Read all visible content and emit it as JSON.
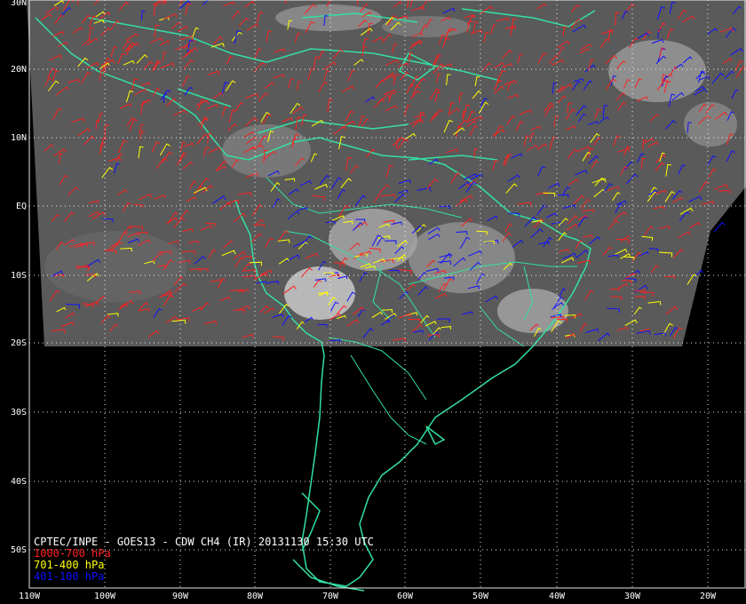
{
  "title": "CPTEC/INPE - GOES13 - CDW CH4 (IR) 20131130 15:30 UTC",
  "legend": [
    {
      "label": "1000-700 hPa",
      "color": "#ff2020"
    },
    {
      "label": "701-400 hPa",
      "color": "#ffff00"
    },
    {
      "label": "401-100 hPa",
      "color": "#1010ff"
    }
  ],
  "lat_labels": [
    "30N",
    "20N",
    "10N",
    "EQ",
    "10S",
    "20S",
    "30S",
    "40S",
    "50S"
  ],
  "lon_labels": [
    "110W",
    "100W",
    "90W",
    "80W",
    "70W",
    "60W",
    "50W",
    "40W",
    "30W",
    "20W"
  ],
  "colors": {
    "background": "#000000",
    "coastline": "#33e0a0",
    "grid": "#ffffff",
    "satellite": "#5a5a5a"
  }
}
